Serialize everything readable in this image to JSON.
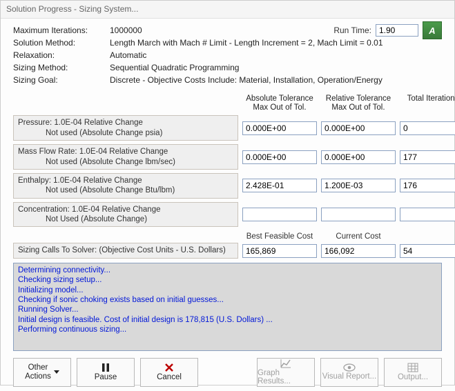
{
  "window": {
    "title": "Solution Progress - Sizing System..."
  },
  "runtime": {
    "label": "Run Time:",
    "value": "1.90"
  },
  "info": {
    "max_iter_lbl": "Maximum Iterations:",
    "max_iter_val": "1000000",
    "method_lbl": "Solution Method:",
    "method_val": "Length March with Mach # Limit - Length Increment = 2, Mach Limit = 0.01",
    "relax_lbl": "Relaxation:",
    "relax_val": "Automatic",
    "sizing_method_lbl": "Sizing Method:",
    "sizing_method_val": "Sequential Quadratic Programming",
    "sizing_goal_lbl": "Sizing Goal:",
    "sizing_goal_val": "Discrete - Objective Costs Include: Material, Installation, Operation/Energy"
  },
  "headers": {
    "abs": "Absolute Tolerance\nMax Out of Tol.",
    "rel": "Relative Tolerance\nMax Out of Tol.",
    "tot": "Total Iterations"
  },
  "params": [
    {
      "label": "Pressure: 1.0E-04 Relative Change",
      "sub": "Not used (Absolute Change psia)",
      "abs": "0.000E+00",
      "rel": "0.000E+00",
      "tot": "0"
    },
    {
      "label": "Mass Flow Rate: 1.0E-04 Relative Change",
      "sub": "Not used (Absolute Change lbm/sec)",
      "abs": "0.000E+00",
      "rel": "0.000E+00",
      "tot": "177"
    },
    {
      "label": "Enthalpy: 1.0E-04 Relative Change",
      "sub": "Not used (Absolute Change Btu/lbm)",
      "abs": "2.428E-01",
      "rel": "1.200E-03",
      "tot": "176"
    },
    {
      "label": "Concentration: 1.0E-04 Relative Change",
      "sub": "Not Used (Absolute Change)",
      "abs": "",
      "rel": "",
      "tot": ""
    }
  ],
  "cost": {
    "solver_lbl": "Sizing Calls To Solver: (Objective Cost Units - U.S. Dollars)",
    "best_lbl": "Best Feasible Cost",
    "current_lbl": "Current Cost",
    "best_val": "165,869",
    "current_val": "166,092",
    "calls_val": "54"
  },
  "log": [
    "Determining connectivity...",
    "Checking sizing setup...",
    "Initializing model...",
    "Checking if sonic choking exists based on initial guesses...",
    "Running Solver...",
    "Initial design is feasible. Cost of initial design is 178,815 (U.S. Dollars) ...",
    "Performing continuous sizing..."
  ],
  "buttons": {
    "other": "Other\nActions",
    "pause": "Pause",
    "cancel": "Cancel",
    "graph": "Graph Results...",
    "visual": "Visual Report...",
    "output": "Output..."
  }
}
